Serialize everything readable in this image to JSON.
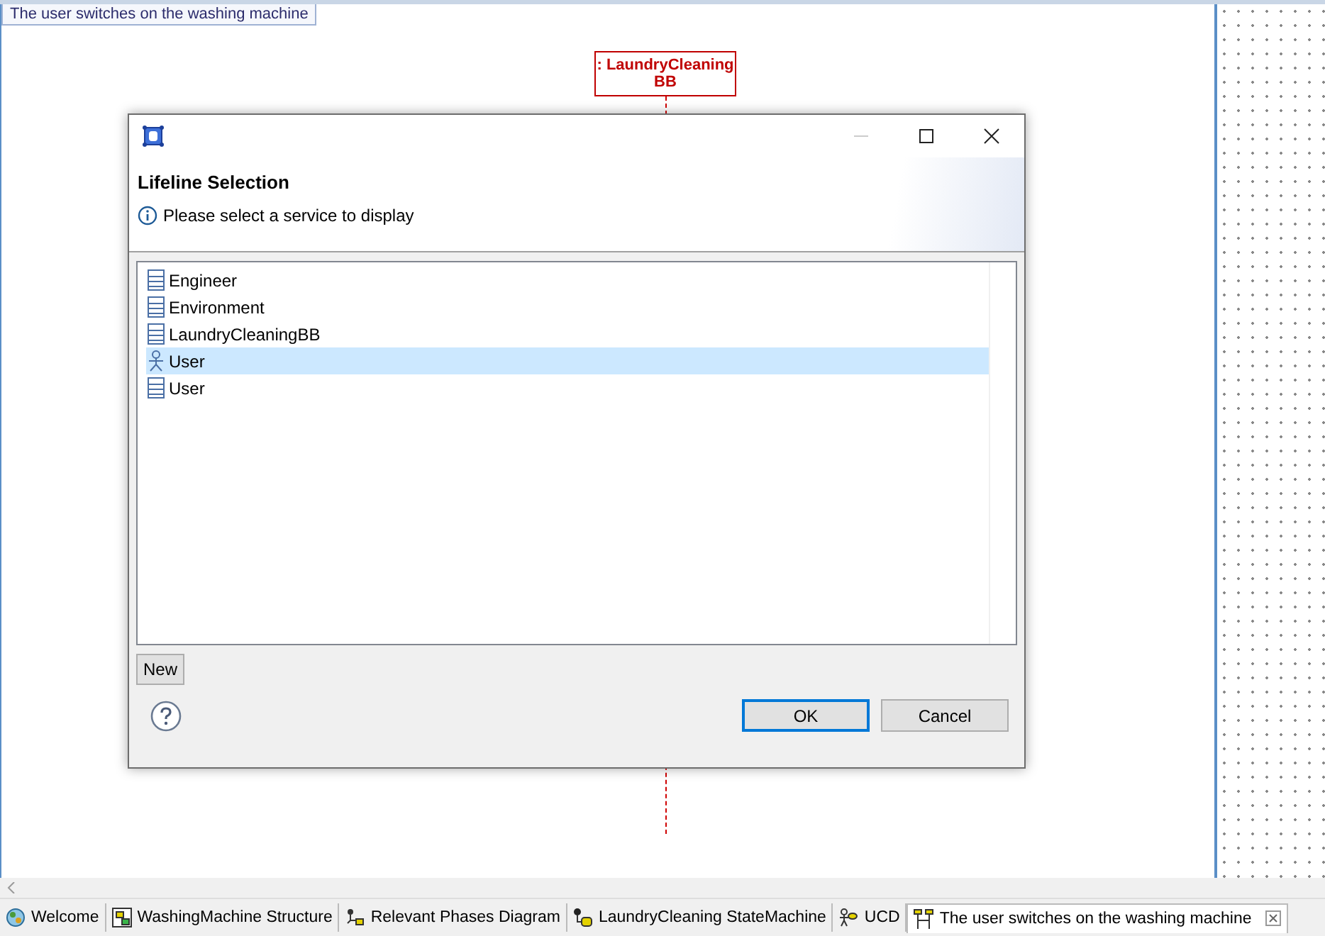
{
  "diagram": {
    "frame_label": "The user switches on the washing machine",
    "lifeline": {
      "label": ": LaundryCleaningBB"
    }
  },
  "dialog": {
    "title": "Lifeline Selection",
    "message": "Please select a service to display",
    "items": [
      {
        "label": "Engineer",
        "kind": "class",
        "selected": false
      },
      {
        "label": "Environment",
        "kind": "class",
        "selected": false
      },
      {
        "label": "LaundryCleaningBB",
        "kind": "class",
        "selected": false
      },
      {
        "label": "User",
        "kind": "actor",
        "selected": true
      },
      {
        "label": "User",
        "kind": "class",
        "selected": false
      }
    ],
    "new_button": "New",
    "buttons": [
      {
        "label": "OK",
        "default": true
      },
      {
        "label": "Cancel",
        "default": false
      }
    ]
  },
  "editor_tabs": [
    {
      "label": "Welcome",
      "kind": "welcome",
      "selected": false
    },
    {
      "label": "WashingMachine Structure",
      "kind": "structure",
      "selected": false
    },
    {
      "label": "Relevant Phases Diagram",
      "kind": "phases",
      "selected": false
    },
    {
      "label": "LaundryCleaning StateMachine",
      "kind": "statemachine",
      "selected": false
    },
    {
      "label": "UCD",
      "kind": "ucd",
      "selected": false
    },
    {
      "label": "The user switches on the washing machine",
      "kind": "sequence",
      "selected": true
    }
  ]
}
